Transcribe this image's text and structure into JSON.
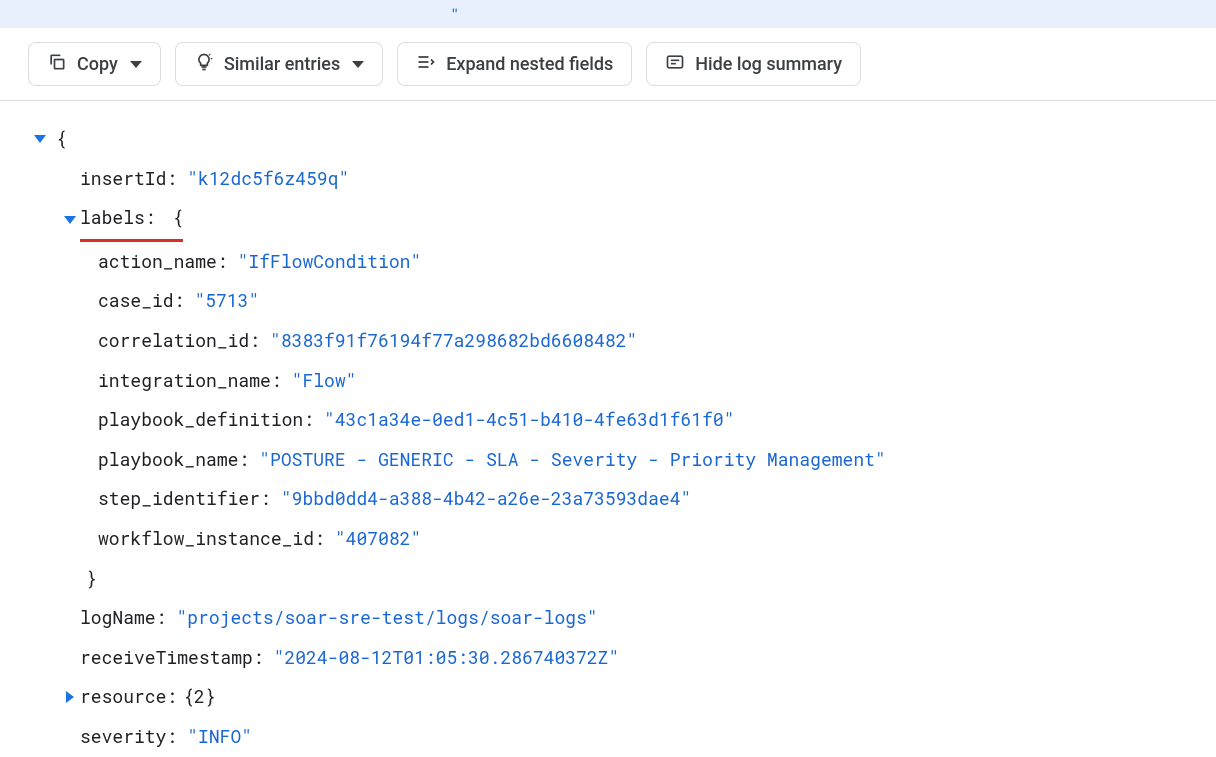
{
  "top_banner": {
    "fragment": "\""
  },
  "toolbar": {
    "copy_label": "Copy",
    "similar_label": "Similar entries",
    "expand_label": "Expand nested fields",
    "hide_summary_label": "Hide log summary"
  },
  "log": {
    "open_brace": "{",
    "insertId_key": "insertId",
    "insertId_val": "\"k12dc5f6z459q\"",
    "labels_key": "labels",
    "labels_open": "{",
    "labels": {
      "action_name_key": "action_name",
      "action_name_val": "\"IfFlowCondition\"",
      "case_id_key": "case_id",
      "case_id_val": "\"5713\"",
      "correlation_id_key": "correlation_id",
      "correlation_id_val": "\"8383f91f76194f77a298682bd6608482\"",
      "integration_name_key": "integration_name",
      "integration_name_val": "\"Flow\"",
      "playbook_definition_key": "playbook_definition",
      "playbook_definition_val": "\"43c1a34e-0ed1-4c51-b410-4fe63d1f61f0\"",
      "playbook_name_key": "playbook_name",
      "playbook_name_val": "\"POSTURE - GENERIC - SLA - Severity - Priority Management\"",
      "step_identifier_key": "step_identifier",
      "step_identifier_val": "\"9bbd0dd4-a388-4b42-a26e-23a73593dae4\"",
      "workflow_instance_id_key": "workflow_instance_id",
      "workflow_instance_id_val": "\"407082\""
    },
    "labels_close": "}",
    "logName_key": "logName",
    "logName_val": "\"projects/soar-sre-test/logs/soar-logs\"",
    "receiveTimestamp_key": "receiveTimestamp",
    "receiveTimestamp_val": "\"2024-08-12T01:05:30.286740372Z\"",
    "resource_key": "resource",
    "resource_summary": "{2}",
    "severity_key": "severity",
    "severity_val": "\"INFO\""
  }
}
